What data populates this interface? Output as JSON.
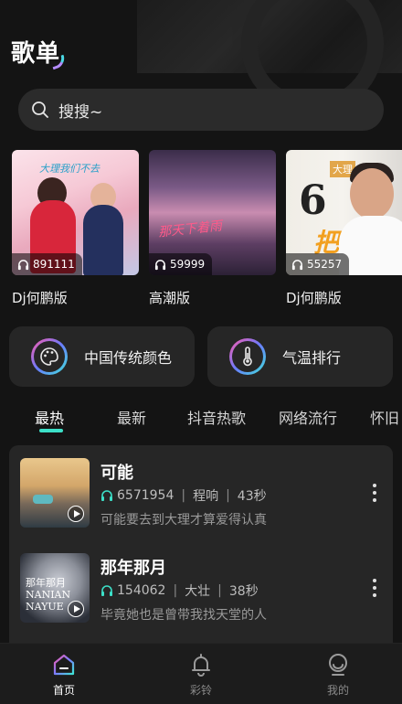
{
  "header": {
    "title": "歌单"
  },
  "search": {
    "placeholder": "搜搜~"
  },
  "playlists": [
    {
      "name": "Dj何鹏版",
      "plays": "891111",
      "cover_text": "大理我们不去"
    },
    {
      "name": "高潮版",
      "plays": "59999",
      "cover_text": "那天下着雨"
    },
    {
      "name": "Dj何鹏版",
      "plays": "55257",
      "cover_text": "6",
      "cover_tag": "大理",
      "cover_brush": "把刀"
    }
  ],
  "features": [
    {
      "label": "中国传统颜色",
      "icon": "palette-icon"
    },
    {
      "label": "气温排行",
      "icon": "thermometer-icon"
    }
  ],
  "tabs": [
    "最热",
    "最新",
    "抖音热歌",
    "网络流行",
    "怀旧"
  ],
  "active_tab": "最热",
  "songs": [
    {
      "title": "可能",
      "plays": "6571954",
      "artist": "程响",
      "duration": "43秒",
      "lyric": "可能要去到大理才算爱得认真"
    },
    {
      "title": "那年那月",
      "plays": "154062",
      "artist": "大壮",
      "duration": "38秒",
      "lyric": "毕竟她也是曾带我找天堂的人",
      "cover_text": "那年那月 NANIAN NAYUE"
    }
  ],
  "tabbar": [
    {
      "label": "首页",
      "icon": "home-icon",
      "active": true
    },
    {
      "label": "彩铃",
      "icon": "bell-icon",
      "active": false
    },
    {
      "label": "我的",
      "icon": "profile-icon",
      "active": false
    }
  ],
  "colors": {
    "accent": "#3ce0c8",
    "background": "#141414",
    "card": "#262626"
  }
}
